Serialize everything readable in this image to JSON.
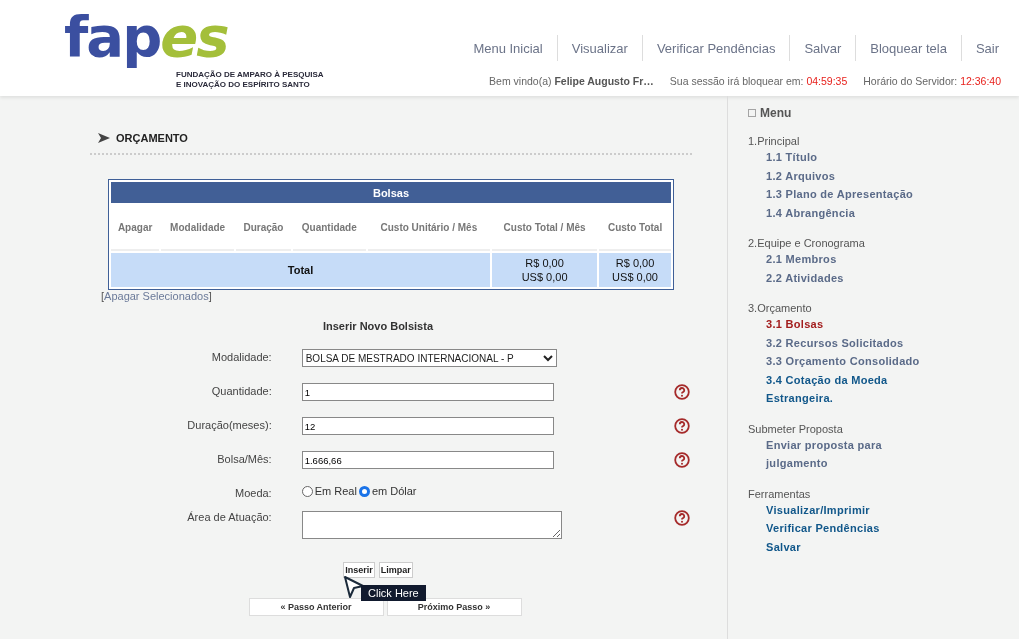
{
  "logo": {
    "mark_part_1": "fap",
    "mark_part_2": "es",
    "tagline_1": "FUNDAÇÃO DE AMPARO À PESQUISA",
    "tagline_2": "E INOVAÇÃO DO ESPÍRITO SANTO"
  },
  "top_nav": [
    "Menu Inicial",
    "Visualizar",
    "Verificar Pendências",
    "Salvar",
    "Bloquear tela",
    "Sair"
  ],
  "status": {
    "welcome_label": "Bem vindo(a)",
    "user": "Felipe Augusto Fr…",
    "session_label": "Sua sessão irá bloquear em:",
    "session_time": "04:59:35",
    "server_label": "Horário do Servidor:",
    "server_time": "12:36:40"
  },
  "section_title": "ORÇAMENTO",
  "table": {
    "title": "Bolsas",
    "columns": [
      "Apagar",
      "Modalidade",
      "Duração",
      "Quantidade",
      "Custo Unitário / Mês",
      "Custo Total / Mês",
      "Custo Total"
    ],
    "total_row": {
      "label": "Total",
      "monthly": [
        "R$ 0,00",
        "US$ 0,00"
      ],
      "total": [
        "R$ 0,00",
        "US$ 0,00"
      ]
    }
  },
  "delete_link": {
    "open": "[",
    "label": "Apagar Selecionados",
    "close": "]"
  },
  "form": {
    "title": "Inserir Novo Bolsista",
    "fields": [
      {
        "kind": "select",
        "label": "Modalidade:",
        "value": "BOLSA DE MESTRADO INTERNACIONAL - P",
        "help": false
      },
      {
        "kind": "text",
        "label": "Quantidade:",
        "value": "1",
        "help": true
      },
      {
        "kind": "text",
        "label": "Duração(meses):",
        "value": "12",
        "help": true
      },
      {
        "kind": "text",
        "label": "Bolsa/Mês:",
        "value": "1.666,66",
        "help": true
      },
      {
        "kind": "radio",
        "label": "Moeda:",
        "options": [
          {
            "label": "Em Real",
            "selected": false
          },
          {
            "label": "em Dólar",
            "selected": true
          }
        ],
        "help": false
      },
      {
        "kind": "textarea",
        "label": "Área de Atuação:",
        "help": true
      }
    ],
    "buttons": [
      "Inserir",
      "Limpar"
    ],
    "tooltip": "Click Here"
  },
  "pager": [
    "« Passo Anterior",
    "Próximo Passo »"
  ],
  "sidebar": {
    "title": "Menu",
    "groups": [
      {
        "heading": "1.Principal",
        "items": [
          {
            "label": "1.1 Título",
            "selected": false,
            "color": "#5a6a88"
          },
          {
            "label": "1.2 Arquivos",
            "selected": false,
            "color": "#5a6a88"
          },
          {
            "label": "1.3 Plano de Apresentação",
            "selected": false,
            "color": "#5a6a88"
          },
          {
            "label": "1.4 Abrangência",
            "selected": false,
            "color": "#5a6a88"
          }
        ]
      },
      {
        "heading": "2.Equipe e Cronograma",
        "items": [
          {
            "label": "2.1 Membros",
            "selected": false,
            "color": "#5a6a88"
          },
          {
            "label": "2.2 Atividades",
            "selected": false,
            "color": "#5a6a88"
          }
        ]
      },
      {
        "heading": "3.Orçamento",
        "items": [
          {
            "label": "3.1 Bolsas",
            "selected": true
          },
          {
            "label": "3.2 Recursos Solicitados",
            "selected": false,
            "color": "#5a6a88"
          },
          {
            "label": "3.3 Orçamento Consolidado",
            "selected": false,
            "color": "#5a6a88"
          },
          {
            "label": "3.4 Cotação da Moeda Estrangeira.",
            "selected": false,
            "color": "#11578a"
          }
        ]
      },
      {
        "heading": "Submeter Proposta",
        "items": [
          {
            "label": "Enviar proposta para julgamento",
            "selected": false,
            "color": "#5a6a88"
          }
        ]
      },
      {
        "heading": "Ferramentas",
        "items": [
          {
            "label": "Visualizar/Imprimir",
            "selected": false,
            "color": "#11578a"
          },
          {
            "label": "Verificar Pendências",
            "selected": false,
            "color": "#11578a"
          },
          {
            "label": "Salvar",
            "selected": false,
            "color": "#11578a"
          }
        ]
      }
    ]
  }
}
